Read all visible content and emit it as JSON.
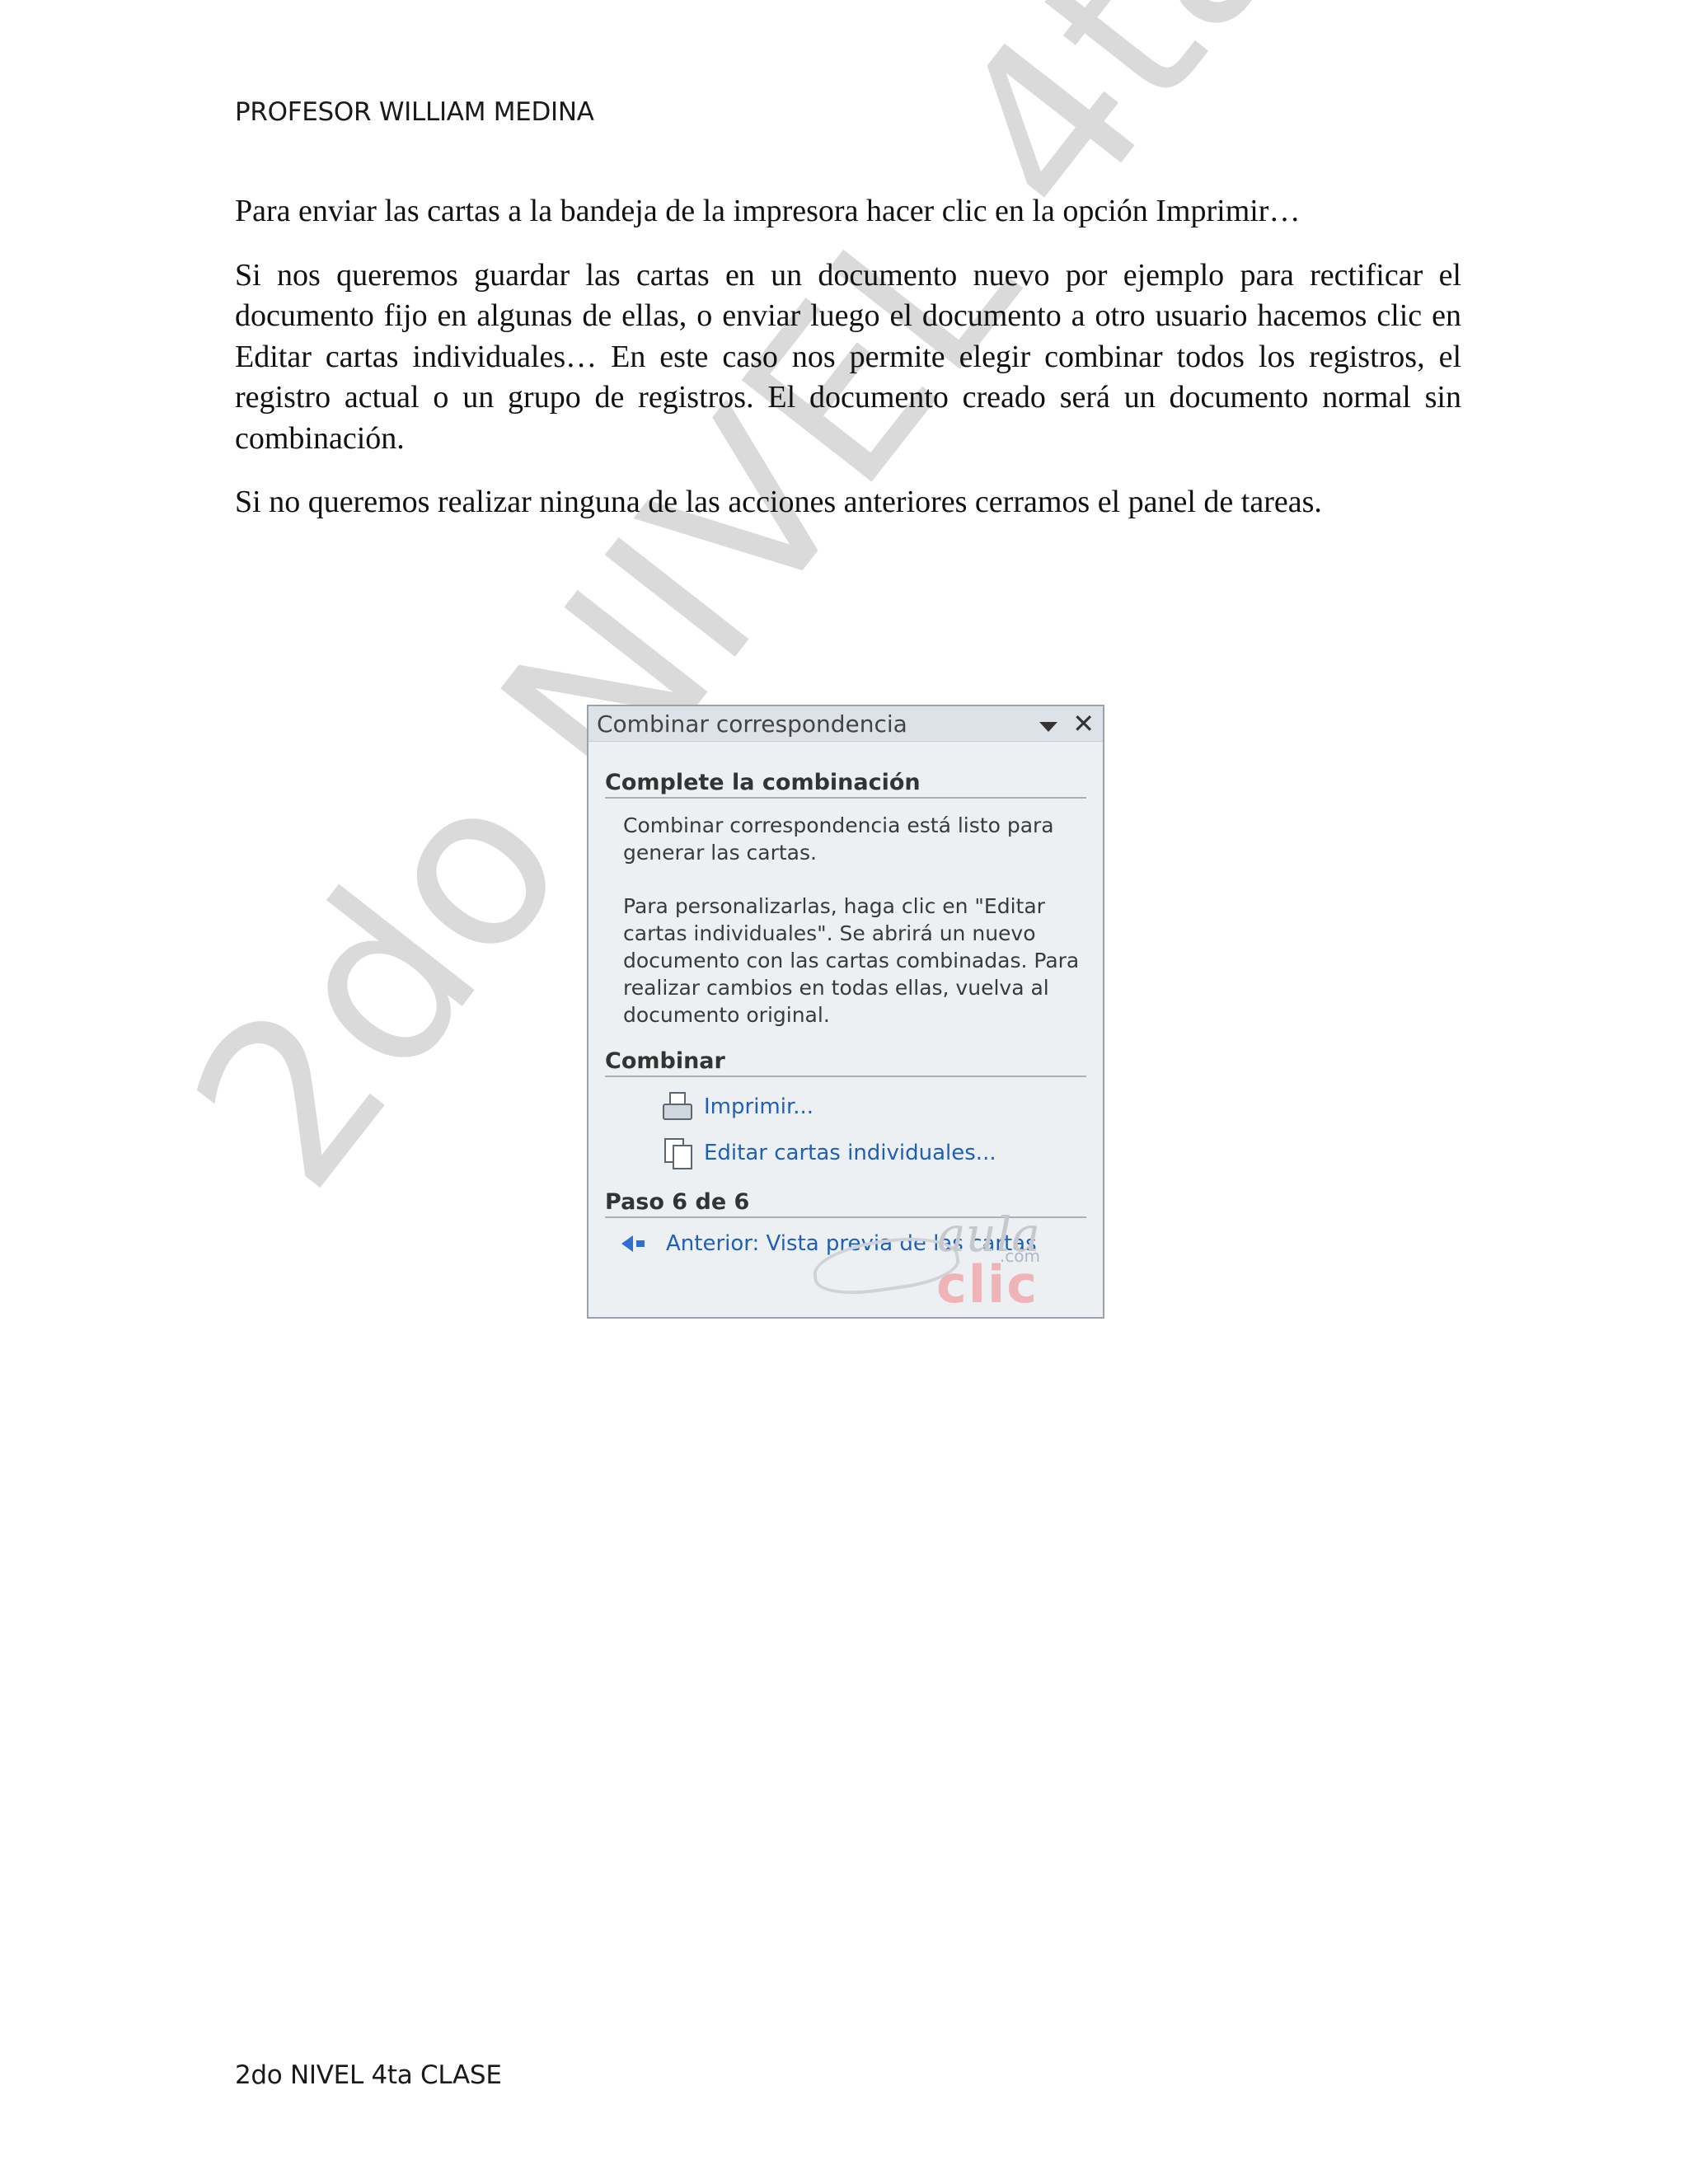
{
  "header": {
    "text": "PROFESOR WILLIAM MEDINA"
  },
  "body": {
    "p1": "Para enviar  las cartas a la bandeja de la impresora hacer clic en la opción Imprimir…",
    "p2": "Si nos queremos guardar las cartas en un documento nuevo por ejemplo para rectificar el documento fijo en algunas de ellas, o enviar luego el documento a otro usuario hacemos clic en Editar cartas individuales… En este caso nos permite elegir combinar todos los registros, el registro actual o un grupo de registros. El documento creado será un documento normal sin combinación.",
    "p3": "Si no queremos realizar ninguna de las acciones anteriores cerramos el panel de tareas."
  },
  "watermark": {
    "text": "2do NIVEL 4ta CLASE"
  },
  "taskpane": {
    "title": "Combinar correspondencia",
    "section1": "Complete la combinación",
    "info1": "Combinar correspondencia está listo para generar las cartas.",
    "info2": "Para personalizarlas, haga clic en \"Editar cartas individuales\". Se abrirá un nuevo documento con las cartas combinadas. Para realizar cambios en todas ellas, vuelva al documento original.",
    "section2": "Combinar",
    "link_print": "Imprimir...",
    "link_edit": "Editar cartas individuales...",
    "section3": "Paso 6 de 6",
    "link_back": "Anterior: Vista previa de las cartas",
    "icons": [
      "dropdown-arrow-icon",
      "close-icon",
      "printer-icon",
      "documents-icon",
      "back-arrow-icon"
    ]
  },
  "logo": {
    "aula": "aula",
    "com": ".com",
    "clic": "clic"
  },
  "footer": {
    "text": "2do NIVEL 4ta CLASE"
  }
}
